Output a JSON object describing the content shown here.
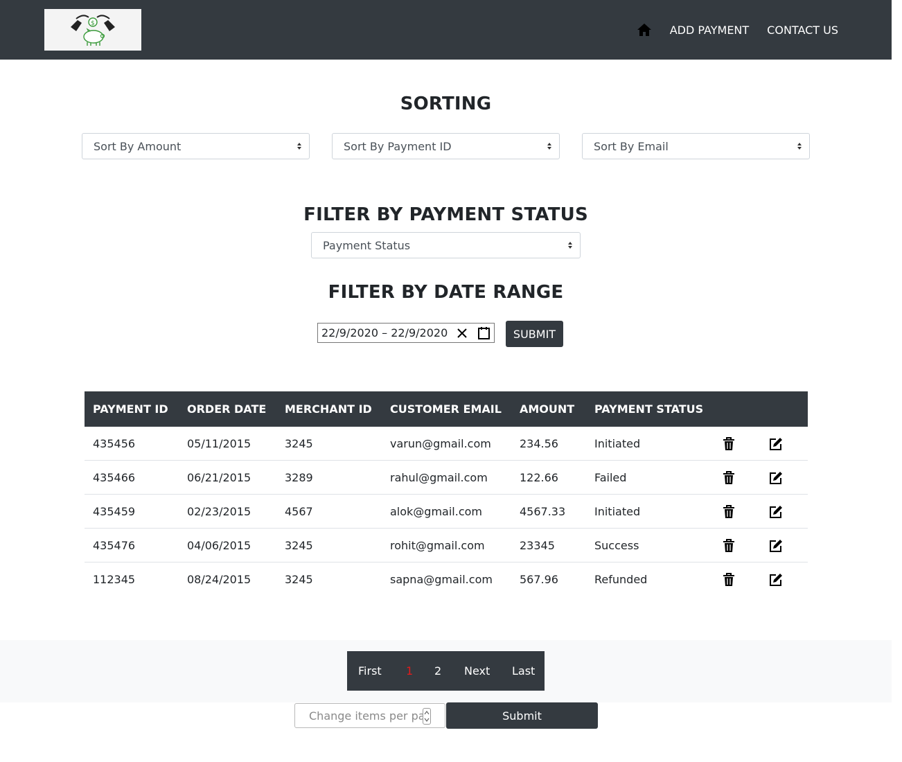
{
  "nav": {
    "links": [
      "ADD PAYMENT",
      "CONTACT US"
    ]
  },
  "sorting": {
    "title": "SORTING",
    "selects": [
      "Sort By Amount",
      "Sort By Payment ID",
      "Sort By Email"
    ]
  },
  "status_filter": {
    "title": "FILTER BY PAYMENT STATUS",
    "select": "Payment Status"
  },
  "date_filter": {
    "title": "FILTER BY DATE RANGE",
    "range": "22/9/2020 – 22/9/2020",
    "submit": "SUBMIT"
  },
  "table": {
    "headers": [
      "PAYMENT ID",
      "ORDER DATE",
      "MERCHANT ID",
      "CUSTOMER EMAIL",
      "AMOUNT",
      "PAYMENT STATUS"
    ],
    "rows": [
      [
        "435456",
        "05/11/2015",
        "3245",
        "varun@gmail.com",
        "234.56",
        "Initiated"
      ],
      [
        "435466",
        "06/21/2015",
        "3289",
        "rahul@gmail.com",
        "122.66",
        "Failed"
      ],
      [
        "435459",
        "02/23/2015",
        "4567",
        "alok@gmail.com",
        "4567.33",
        "Initiated"
      ],
      [
        "435476",
        "04/06/2015",
        "3245",
        "rohit@gmail.com",
        "23345",
        "Success"
      ],
      [
        "112345",
        "08/24/2015",
        "3245",
        "sapna@gmail.com",
        "567.96",
        "Refunded"
      ]
    ]
  },
  "pagination": {
    "first": "First",
    "pages": [
      "1",
      "2"
    ],
    "active_page": "1",
    "next": "Next",
    "last": "Last"
  },
  "items_per_page": {
    "placeholder": "Change items per page",
    "submit": "Submit"
  },
  "colors": {
    "dark": "#343a40",
    "active_page": "#e31b1b",
    "logo_green": "#3a9a3a"
  }
}
